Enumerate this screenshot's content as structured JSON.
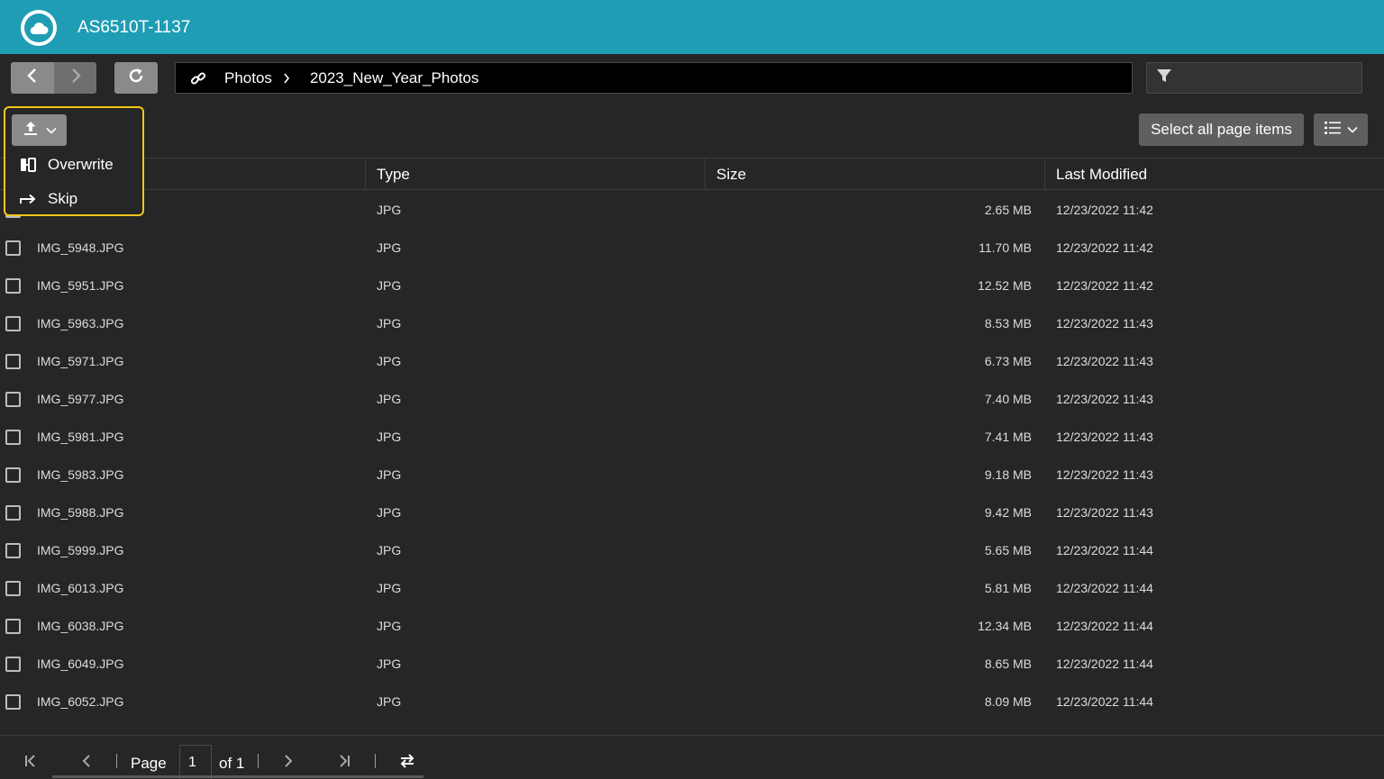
{
  "app": {
    "title": "AS6510T-1137",
    "logo_icon": "cloud-icon",
    "header_color": "#1f9db5"
  },
  "toolbar": {
    "back_icon": "chevron-left-icon",
    "forward_icon": "chevron-right-icon",
    "refresh_icon": "refresh-icon",
    "breadcrumb": [
      "Photos",
      "2023_New_Year_Photos"
    ],
    "filter_placeholder": "",
    "filter_icon": "filter-icon"
  },
  "actions": {
    "select_all_label": "Select all page items",
    "view_icon": "list-view-icon"
  },
  "upload_menu": {
    "upload_icon": "upload-icon",
    "items": [
      {
        "label": "Overwrite",
        "icon": "overwrite-icon"
      },
      {
        "label": "Skip",
        "icon": "skip-arrow-icon"
      }
    ],
    "highlight_color": "#f5c518"
  },
  "table": {
    "columns": [
      "Type",
      "Size",
      "Last Modified"
    ],
    "rows": [
      {
        "name": "",
        "type": "JPG",
        "size": "2.65 MB",
        "modified": "12/23/2022 11:42"
      },
      {
        "name": "IMG_5948.JPG",
        "type": "JPG",
        "size": "11.70 MB",
        "modified": "12/23/2022 11:42"
      },
      {
        "name": "IMG_5951.JPG",
        "type": "JPG",
        "size": "12.52 MB",
        "modified": "12/23/2022 11:42"
      },
      {
        "name": "IMG_5963.JPG",
        "type": "JPG",
        "size": "8.53 MB",
        "modified": "12/23/2022 11:43"
      },
      {
        "name": "IMG_5971.JPG",
        "type": "JPG",
        "size": "6.73 MB",
        "modified": "12/23/2022 11:43"
      },
      {
        "name": "IMG_5977.JPG",
        "type": "JPG",
        "size": "7.40 MB",
        "modified": "12/23/2022 11:43"
      },
      {
        "name": "IMG_5981.JPG",
        "type": "JPG",
        "size": "7.41 MB",
        "modified": "12/23/2022 11:43"
      },
      {
        "name": "IMG_5983.JPG",
        "type": "JPG",
        "size": "9.18 MB",
        "modified": "12/23/2022 11:43"
      },
      {
        "name": "IMG_5988.JPG",
        "type": "JPG",
        "size": "9.42 MB",
        "modified": "12/23/2022 11:43"
      },
      {
        "name": "IMG_5999.JPG",
        "type": "JPG",
        "size": "5.65 MB",
        "modified": "12/23/2022 11:44"
      },
      {
        "name": "IMG_6013.JPG",
        "type": "JPG",
        "size": "5.81 MB",
        "modified": "12/23/2022 11:44"
      },
      {
        "name": "IMG_6038.JPG",
        "type": "JPG",
        "size": "12.34 MB",
        "modified": "12/23/2022 11:44"
      },
      {
        "name": "IMG_6049.JPG",
        "type": "JPG",
        "size": "8.65 MB",
        "modified": "12/23/2022 11:44"
      },
      {
        "name": "IMG_6052.JPG",
        "type": "JPG",
        "size": "8.09 MB",
        "modified": "12/23/2022 11:44"
      }
    ]
  },
  "pagination": {
    "page_label": "Page",
    "current_page": "1",
    "of_label": "of 1",
    "first_icon": "first-page-icon",
    "prev_icon": "prev-page-icon",
    "next_icon": "next-page-icon",
    "last_icon": "last-page-icon",
    "refresh_icon": "sync-icon"
  }
}
